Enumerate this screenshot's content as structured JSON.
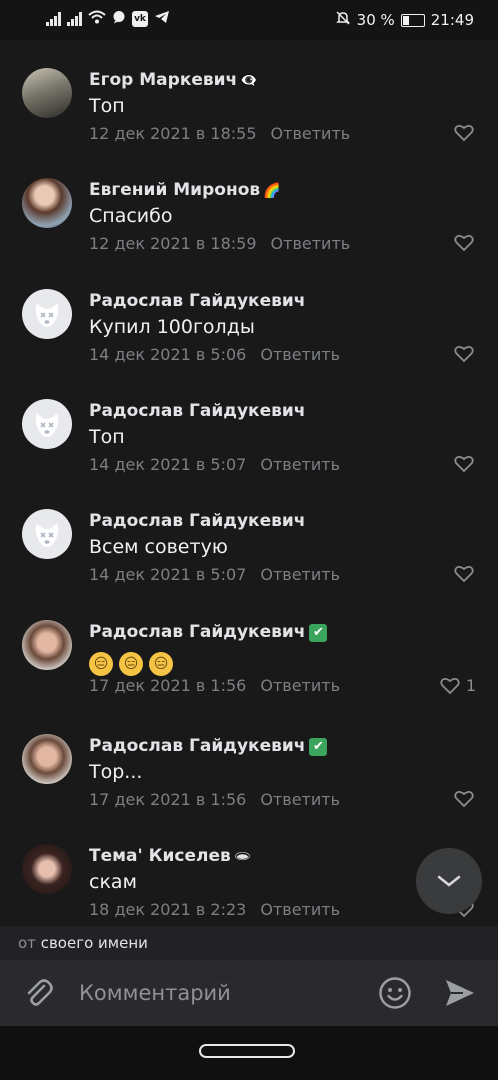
{
  "status_bar": {
    "battery": "30 %",
    "time": "21:49",
    "vk_badge": "vk"
  },
  "comments": [
    {
      "name": "Егор Маркевич",
      "name_emoji": "👁‍🗨",
      "text": "Топ",
      "date": "12 дек 2021 в 18:55",
      "reply": "Ответить",
      "likes": "",
      "avatar": "photo-man"
    },
    {
      "name": "Евгений Миронов",
      "name_emoji": "🌈",
      "text": "Спасибо",
      "date": "12 дек 2021 в 18:59",
      "reply": "Ответить",
      "likes": "",
      "avatar": "photo-girl-hair"
    },
    {
      "name": "Радослав Гайдукевич",
      "name_emoji": "",
      "text": "Купил 100голды",
      "date": "14 дек 2021 в 5:06",
      "reply": "Ответить",
      "likes": "",
      "avatar": "deactivated-dog"
    },
    {
      "name": "Радослав Гайдукевич",
      "name_emoji": "",
      "text": "Топ",
      "date": "14 дек 2021 в 5:07",
      "reply": "Ответить",
      "likes": "",
      "avatar": "deactivated-dog"
    },
    {
      "name": "Радослав Гайдукевич",
      "name_emoji": "",
      "text": "Всем советую",
      "date": "14 дек 2021 в 5:07",
      "reply": "Ответить",
      "likes": "",
      "avatar": "deactivated-dog"
    },
    {
      "name": "Радослав Гайдукевич",
      "name_emoji": "✔",
      "text": "",
      "text_emojis": [
        "😑",
        "😑",
        "😑"
      ],
      "date": "17 дек 2021 в 1:56",
      "reply": "Ответить",
      "likes": "1",
      "avatar": "selfie"
    },
    {
      "name": "Радослав Гайдукевич",
      "name_emoji": "✔",
      "text": "Тор...",
      "date": "17 дек 2021 в 1:56",
      "reply": "Ответить",
      "likes": "",
      "avatar": "selfie"
    },
    {
      "name": "Тема' Киселев",
      "name_emoji": "🕳",
      "text": "скам",
      "date": "18 дек 2021 в 2:23",
      "reply": "Ответить",
      "likes": "",
      "avatar": "photo-girl"
    }
  ],
  "from_bar": {
    "prefix": "от",
    "value": "своего имени"
  },
  "composer": {
    "placeholder": "Комментарий"
  },
  "icons": {
    "attach": "paperclip-icon",
    "emoji": "smiley-icon",
    "send": "send-icon",
    "scroll_down": "chevron-down-icon",
    "like": "heart-icon"
  }
}
